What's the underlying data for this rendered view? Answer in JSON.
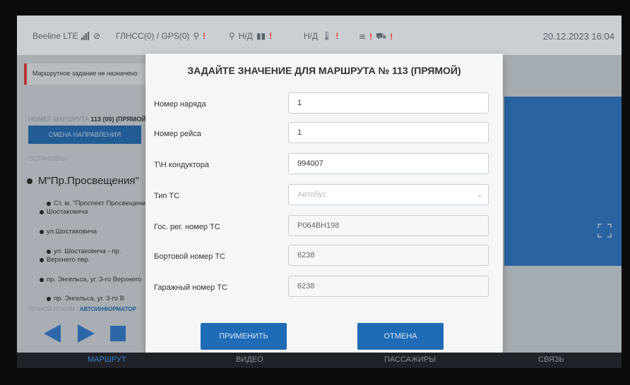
{
  "status_bar": {
    "network": "Beeline LTE",
    "gnss": "ГЛНСС(0) / GPS(0)",
    "temp_left": "Н/Д",
    "temp_right": "Н/Д",
    "datetime": "20.12.2023  16:04"
  },
  "left_panel": {
    "notice": "Маршрутное задание не назначено",
    "route_label": "НОМЕР МАРШРУТА",
    "route_value": "113 (00) (ПРЯМОЙ)",
    "direction_button": "СМЕНА НАПРАВЛЕНИЯ",
    "stops_header": "ОСТАНОВКИ",
    "stop_main": "М\"Пр.Просвещения\"",
    "stops": [
      "Ст. м. \"Проспект Просвещения\" -",
      "Шостаковича",
      "ул.Шостаковича",
      "ул. Шостаковича - пр.",
      "Верхнего пер.",
      "пр. Энгельса, уг. 3-го Верхнего",
      "пр. Энгельса, уг. 3-го В"
    ],
    "mode_label": "РУЧНОЙ РЕЖИМ",
    "mode_value": "АВТОИНФОРМАТОР"
  },
  "modal": {
    "title": "ЗАДАЙТЕ ЗНАЧЕНИЕ ДЛЯ МАРШРУТА № 113 (ПРЯМОЙ)",
    "fields": [
      {
        "label": "Номер наряда",
        "value": "1"
      },
      {
        "label": "Номер рейса",
        "value": "1"
      },
      {
        "label": "Т\\Н кондуктора",
        "value": "994007"
      },
      {
        "label": "Тип ТС",
        "value": "Автобус"
      },
      {
        "label": "Гос. рег. номер ТС",
        "value": "Р064ВН198"
      },
      {
        "label": "Бортовой номер ТС",
        "value": "6238"
      },
      {
        "label": "Гаражный номер ТС",
        "value": "6238"
      }
    ],
    "apply": "ПРИМЕНИТЬ",
    "cancel": "ОТМЕНА"
  },
  "tabs": [
    {
      "label": "МАРШРУТ",
      "active": true
    },
    {
      "label": "ВИДЕО",
      "active": false
    },
    {
      "label": "ПАССАЖИРЫ",
      "active": false
    },
    {
      "label": "СВЯЗЬ",
      "active": false
    }
  ],
  "colors": {
    "accent": "#1f6bb5",
    "warning": "#e53935",
    "map_panel": "#2a74c4"
  }
}
